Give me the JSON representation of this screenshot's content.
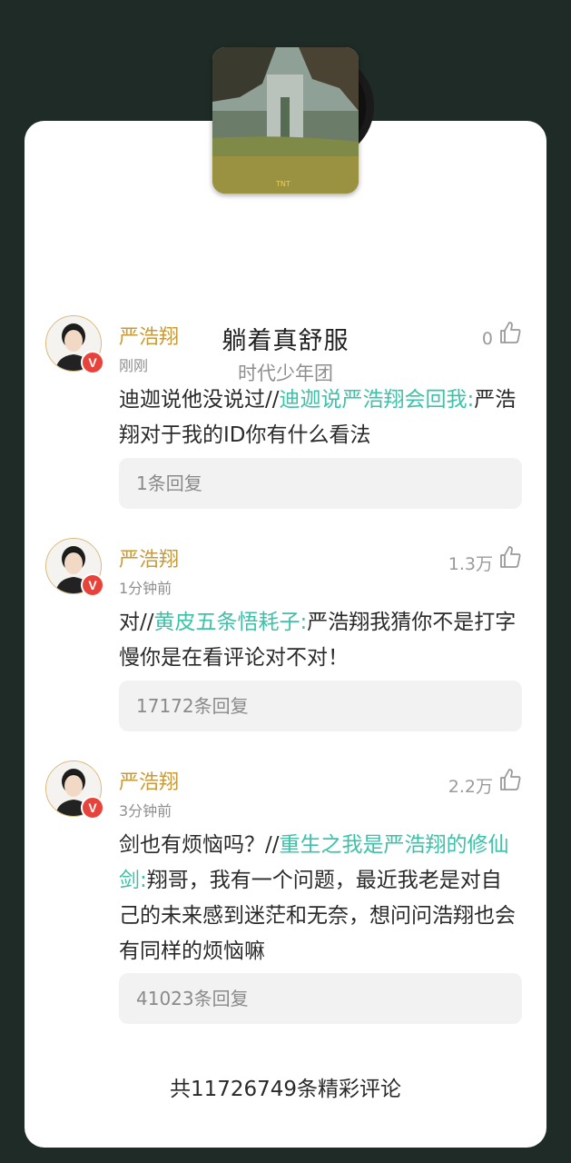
{
  "song": {
    "title": "躺着真舒服",
    "artist": "时代少年团"
  },
  "comments": [
    {
      "username": "严浩翔",
      "time": "刚刚",
      "likes": "0",
      "text_prefix": "迪迦说他没说过//",
      "mention": "迪迦说严浩翔会回我:",
      "text_suffix": "严浩翔对于我的ID你有什么看法",
      "replies": "1条回复"
    },
    {
      "username": "严浩翔",
      "time": "1分钟前",
      "likes": "1.3万",
      "text_prefix": "对//",
      "mention": "黄皮五条悟耗子:",
      "text_suffix": "严浩翔我猜你不是打字慢你是在看评论对不对！",
      "replies": "17172条回复"
    },
    {
      "username": "严浩翔",
      "time": "3分钟前",
      "likes": "2.2万",
      "text_prefix": "剑也有烦恼吗？//",
      "mention": "重生之我是严浩翔的修仙剑:",
      "text_suffix": "翔哥，我有一个问题，最近我老是对自己的未来感到迷茫和无奈，想问问浩翔也会有同样的烦恼嘛",
      "replies": "41023条回复"
    }
  ],
  "footer": {
    "total": "共11726749条精彩评论"
  },
  "colors": {
    "background": "#1e2b26",
    "card": "#ffffff",
    "username": "#c89a3a",
    "mention": "#3fc1a8",
    "badge": "#e8433a"
  },
  "icons": {
    "like": "thumbs-up-icon",
    "verified": "v-badge-icon"
  }
}
